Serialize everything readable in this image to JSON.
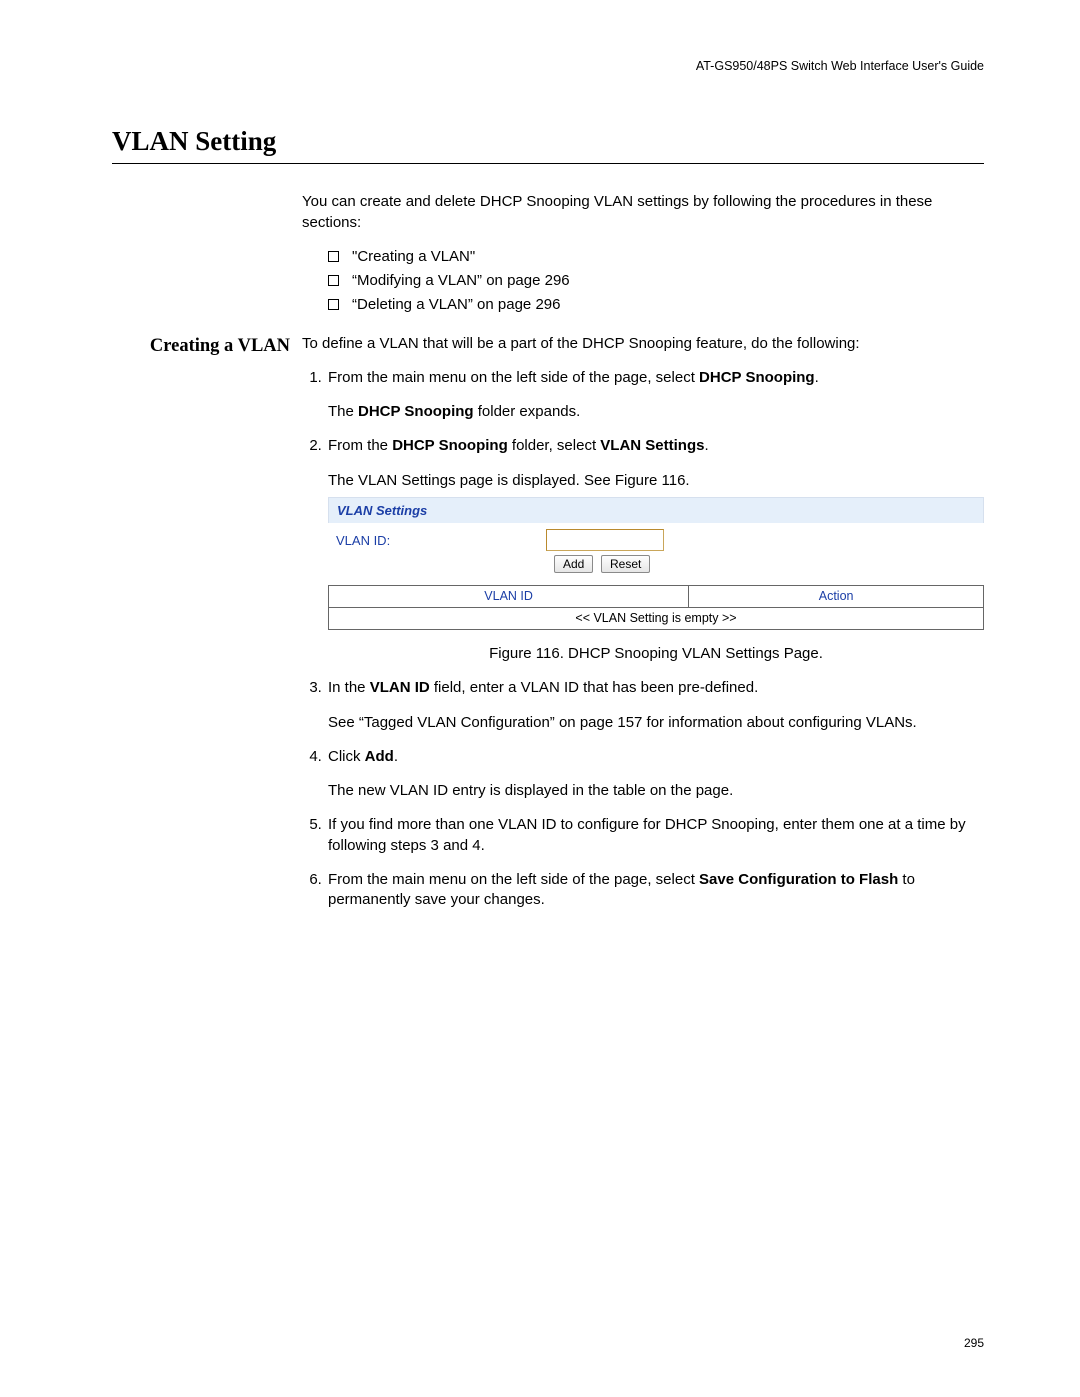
{
  "header": {
    "running_title": "AT-GS950/48PS Switch Web Interface User's Guide"
  },
  "section": {
    "title": "VLAN Setting",
    "intro": "You can create and delete DHCP Snooping VLAN settings by following the procedures in these sections:",
    "toc": [
      "\"Creating a VLAN\"",
      "“Modifying a VLAN” on page 296",
      "“Deleting a VLAN” on page 296"
    ]
  },
  "subsection": {
    "heading": "Creating a VLAN",
    "lead": "To define a VLAN that will be a part of the DHCP Snooping feature, do the following:",
    "steps": {
      "s1_a": "From the main menu on the left side of the page, select ",
      "s1_b": "DHCP Snooping",
      "s1_c": ".",
      "s1_res_a": "The ",
      "s1_res_b": "DHCP Snooping",
      "s1_res_c": " folder expands.",
      "s2_a": "From the ",
      "s2_b": "DHCP Snooping",
      "s2_c": " folder, select ",
      "s2_d": "VLAN Settings",
      "s2_e": ".",
      "s2_res": "The VLAN Settings page is displayed. See Figure 116.",
      "s3_a": "In the ",
      "s3_b": "VLAN ID",
      "s3_c": " field, enter a VLAN ID that has been pre-defined.",
      "s3_res": "See “Tagged VLAN Configuration” on page 157 for information about configuring VLANs.",
      "s4_a": "Click ",
      "s4_b": "Add",
      "s4_c": ".",
      "s4_res": "The new VLAN ID entry is displayed in the table on the page.",
      "s5": "If you find more than one VLAN ID to configure for DHCP Snooping, enter them one at a time by following steps 3 and 4.",
      "s6_a": "From the main menu on the left side of the page, select ",
      "s6_b": "Save Configuration to Flash",
      "s6_c": " to permanently save your changes."
    }
  },
  "figure": {
    "panel_title": "VLAN Settings",
    "vlanid_label": "VLAN ID:",
    "vlanid_value": "",
    "add_btn": "Add",
    "reset_btn": "Reset",
    "col_vlanid": "VLAN ID",
    "col_action": "Action",
    "empty_row": "<< VLAN Setting is empty >>",
    "caption": "Figure 116. DHCP Snooping VLAN Settings Page."
  },
  "footer": {
    "page_number": "295"
  }
}
